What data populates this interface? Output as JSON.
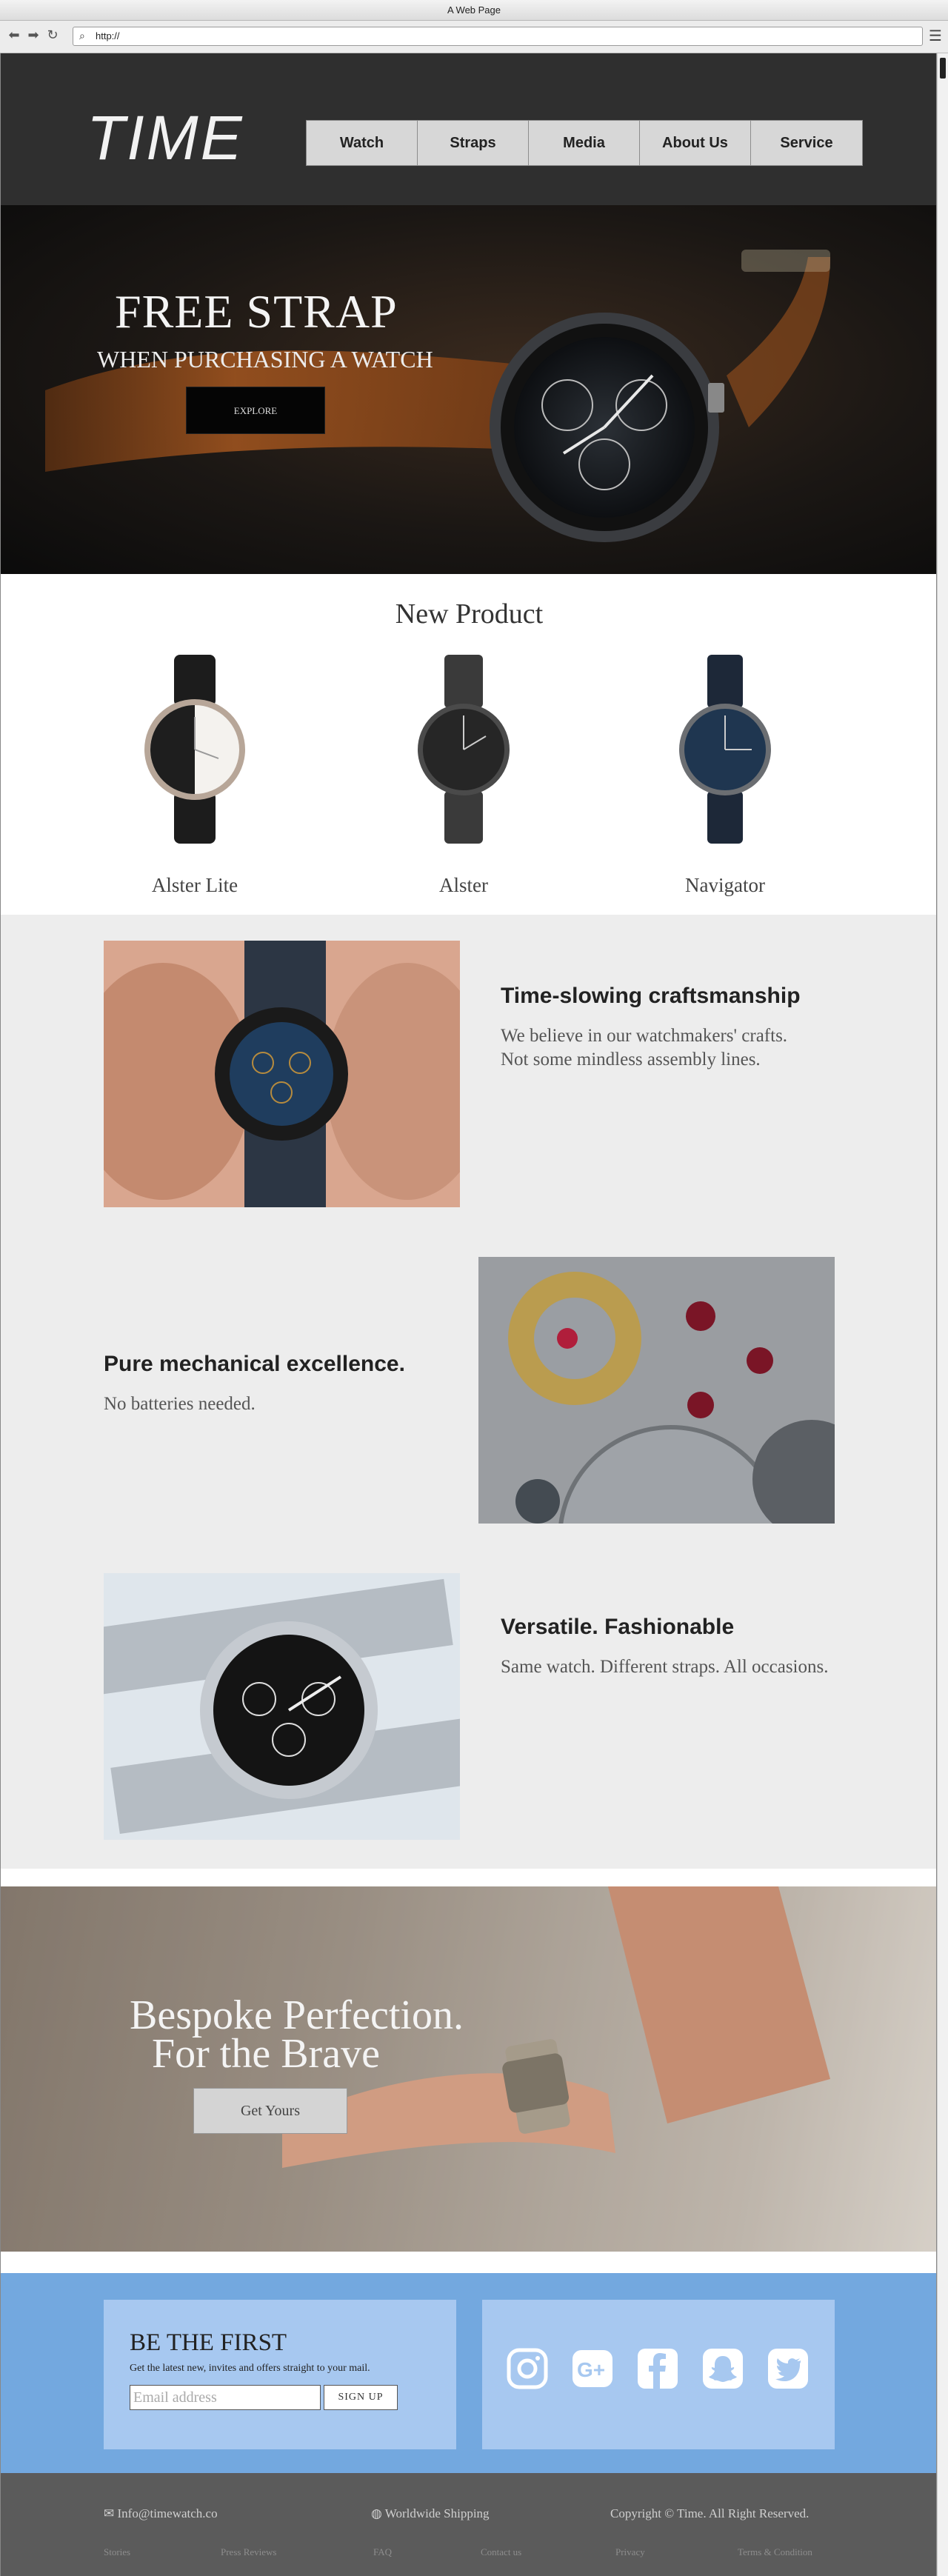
{
  "browser": {
    "title": "A Web Page",
    "url": "http://",
    "back": "⬅",
    "forward": "➡",
    "reload": "↻",
    "menu": "☰"
  },
  "header": {
    "logo": "TIME",
    "nav": [
      "Watch",
      "Straps",
      "Media",
      "About Us",
      "Service"
    ]
  },
  "hero": {
    "title": "FREE STRAP",
    "subtitle": "WHEN PURCHASING A WATCH",
    "button": "EXPLORE"
  },
  "new_product": {
    "title": "New Product",
    "items": [
      "Alster Lite",
      "Alster",
      "Navigator"
    ]
  },
  "features": [
    {
      "title": "Time-slowing craftsmanship",
      "line1": "We believe in our watchmakers' crafts.",
      "line2": "Not some mindless assembly lines."
    },
    {
      "title": "Pure mechanical excellence.",
      "line1": "No batteries needed.",
      "line2": ""
    },
    {
      "title": "Versatile. Fashionable",
      "line1": "Same watch. Different straps. All occasions.",
      "line2": ""
    }
  ],
  "bespoke": {
    "line1": "Bespoke Perfection.",
    "line2": "For the Brave",
    "button": "Get Yours"
  },
  "signup": {
    "title": "BE THE FIRST",
    "text": "Get the latest new, invites and offers straight to your mail.",
    "placeholder": "Email address",
    "button": "SIGN UP",
    "socials": [
      "instagram-icon",
      "google-plus-icon",
      "facebook-icon",
      "snapchat-icon",
      "twitter-icon"
    ]
  },
  "footer": {
    "email": "Info@timewatch.co",
    "shipping": "Worldwide Shipping",
    "copyright": "Copyright © Time. All Right Reserved.",
    "links": [
      "Stories",
      "Press Reviews",
      "FAQ",
      "Contact us",
      "Privacy",
      "Terms & Condition"
    ]
  },
  "colors": {
    "header": "#2f2f2f",
    "nav": "#d7d7d7",
    "features_bg": "#ededed",
    "signup_bg": "#73a8df",
    "signup_box": "#a7c8f0",
    "footer": "#5b5b5b"
  }
}
